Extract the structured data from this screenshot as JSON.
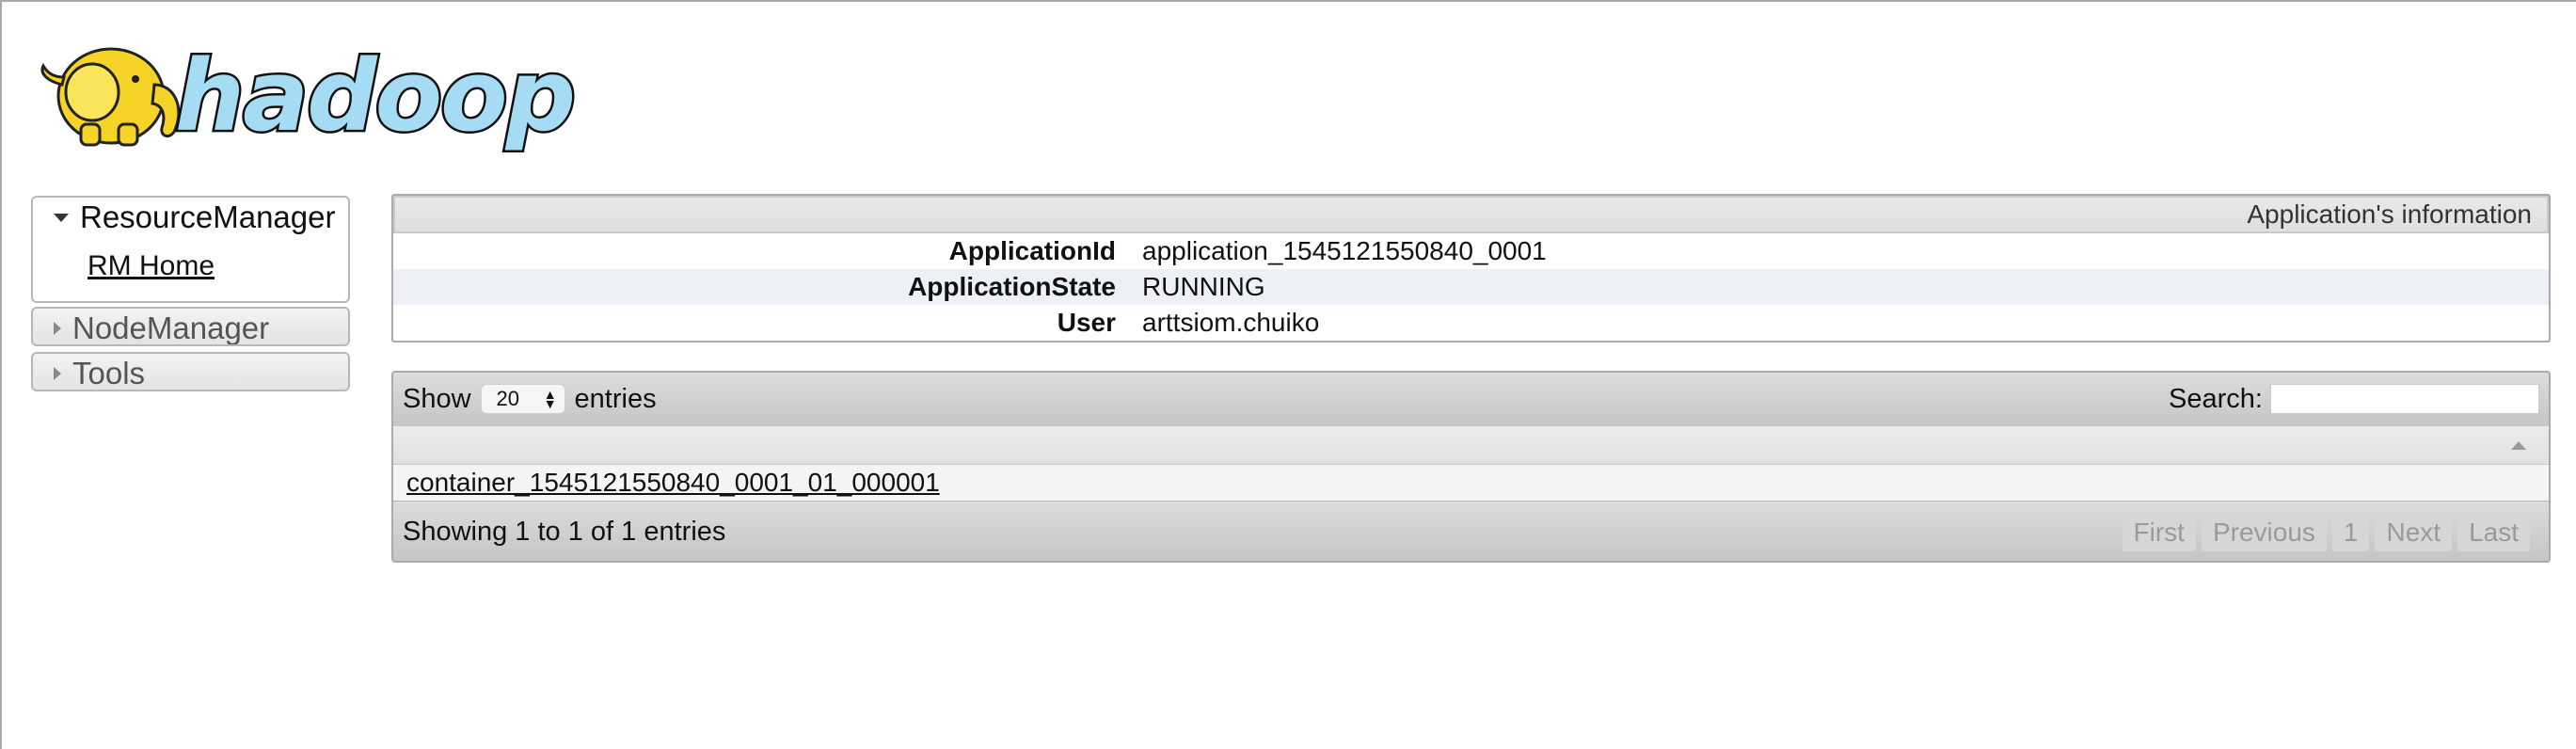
{
  "logo": {
    "text": "hadoop",
    "colors": {
      "elephant": "#f5d327",
      "text_fill": "#a6dbf4",
      "outline": "#111111"
    }
  },
  "nav": {
    "sections": [
      {
        "label": "ResourceManager",
        "expanded": true,
        "items": [
          {
            "label": "RM Home"
          }
        ]
      },
      {
        "label": "NodeManager",
        "expanded": false
      },
      {
        "label": "Tools",
        "expanded": false
      }
    ]
  },
  "info": {
    "caption": "Application's information",
    "rows": [
      {
        "key": "ApplicationId",
        "value": "application_1545121550840_0001"
      },
      {
        "key": "ApplicationState",
        "value": "RUNNING"
      },
      {
        "key": "User",
        "value": "arttsiom.chuiko"
      }
    ]
  },
  "table": {
    "show_label": "Show",
    "entries_value": "20",
    "entries_label": "entries",
    "search_label": "Search:",
    "search_value": "",
    "rows": [
      {
        "container": "container_1545121550840_0001_01_000001"
      }
    ],
    "info_text": "Showing 1 to 1 of 1 entries",
    "pager": {
      "first": "First",
      "previous": "Previous",
      "page": "1",
      "next": "Next",
      "last": "Last"
    }
  }
}
